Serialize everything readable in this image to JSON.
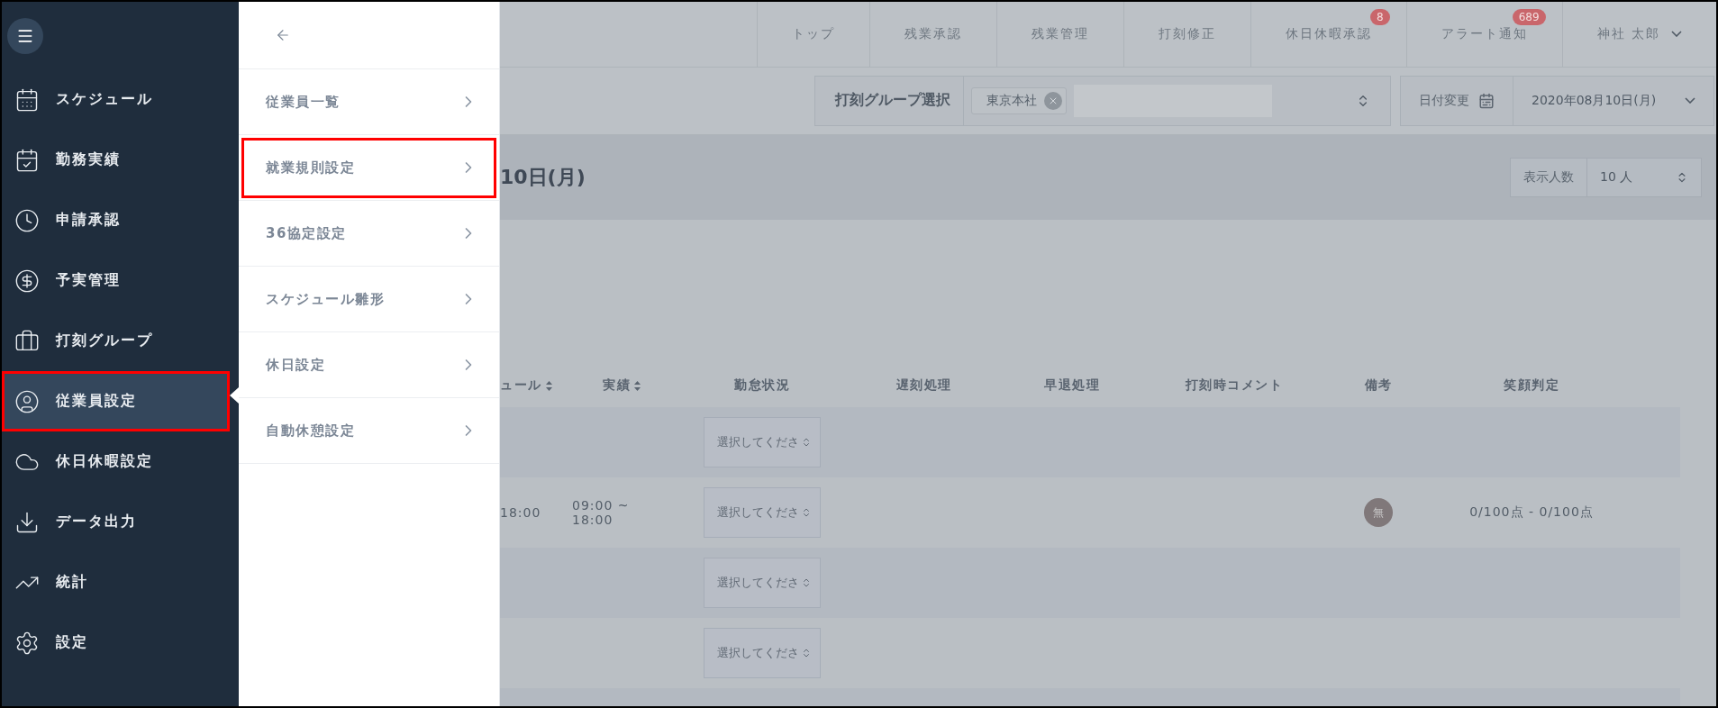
{
  "sidebar": {
    "items": [
      {
        "label": "スケジュール",
        "selected": false,
        "annotated": false
      },
      {
        "label": "勤務実績",
        "selected": false,
        "annotated": false
      },
      {
        "label": "申請承認",
        "selected": false,
        "annotated": false
      },
      {
        "label": "予実管理",
        "selected": false,
        "annotated": false
      },
      {
        "label": "打刻グループ",
        "selected": false,
        "annotated": false
      },
      {
        "label": "従業員設定",
        "selected": true,
        "annotated": true
      },
      {
        "label": "休日休暇設定",
        "selected": false,
        "annotated": false
      },
      {
        "label": "データ出力",
        "selected": false,
        "annotated": false
      },
      {
        "label": "統計",
        "selected": false,
        "annotated": false
      },
      {
        "label": "設定",
        "selected": false,
        "annotated": false
      }
    ]
  },
  "submenu": {
    "items": [
      {
        "label": "従業員一覧",
        "annotated": false
      },
      {
        "label": "就業規則設定",
        "annotated": true
      },
      {
        "label": "36協定設定",
        "annotated": false
      },
      {
        "label": "スケジュール雛形",
        "annotated": false
      },
      {
        "label": "休日設定",
        "annotated": false
      },
      {
        "label": "自動休憩設定",
        "annotated": false
      }
    ]
  },
  "top_nav": {
    "items": [
      {
        "label": "トップ"
      },
      {
        "label": "残業承認"
      },
      {
        "label": "残業管理"
      },
      {
        "label": "打刻修正"
      },
      {
        "label": "休日休暇承認",
        "badge": "8"
      },
      {
        "label": "アラート通知",
        "badge": "689"
      }
    ],
    "user": "神社 太郎"
  },
  "filter": {
    "group_label": "打刻グループ選択",
    "tags": [
      "東京本社"
    ],
    "date_label": "日付変更",
    "date": "2020年08月10日(月)"
  },
  "title": "10日(月)",
  "per_page": {
    "label": "表示人数",
    "value": "10 人"
  },
  "table": {
    "columns": [
      {
        "label": "ュール",
        "sortable": true
      },
      {
        "label": "実績",
        "sortable": true
      },
      {
        "label": "勤怠状況",
        "sortable": false
      },
      {
        "label": "遅刻処理",
        "sortable": false
      },
      {
        "label": "早退処理",
        "sortable": false
      },
      {
        "label": "打刻時コメント",
        "sortable": false
      },
      {
        "label": "備考",
        "sortable": false
      },
      {
        "label": "笑顔判定",
        "sortable": false
      }
    ],
    "rows": [
      {
        "column_1": "",
        "result": "",
        "status": "選択してくださ",
        "note": "",
        "score": ""
      },
      {
        "column_1": "18:00",
        "result": "09:00 ~ 18:00",
        "status": "選択してくださ",
        "note": "無",
        "score": "0/100点 - 0/100点"
      },
      {
        "column_1": "",
        "result": "",
        "status": "選択してくださ",
        "note": "",
        "score": ""
      },
      {
        "column_1": "",
        "result": "",
        "status": "選択してくださ",
        "note": "",
        "score": ""
      }
    ]
  }
}
